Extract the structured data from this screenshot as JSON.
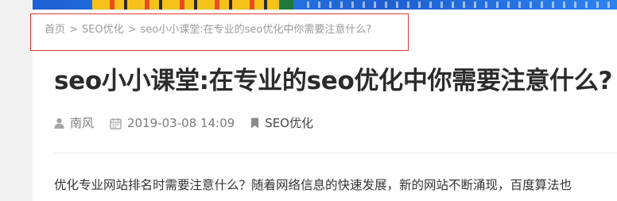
{
  "breadcrumb": {
    "home": "首页",
    "separator": ">",
    "category": "SEO优化",
    "current": "seo小小课堂:在专业的seo优化中你需要注意什么?"
  },
  "article": {
    "title": "seo小小课堂:在专业的seo优化中你需要注意什么?",
    "author": "南风",
    "date": "2019-03-08 14:09",
    "category": "SEO优化",
    "excerpt": "优化专业网站排名时需要注意什么？随着网络信息的快速发展，新的网站不断涌现，百度算法也"
  },
  "colors": {
    "highlight_box": "#d93b3b",
    "banner": "#1d5fd6",
    "title": "#2b2b2b",
    "meta": "#7b7b7b"
  },
  "icons": {
    "author": "user-icon",
    "date": "calendar-icon",
    "category": "bookmark-icon"
  }
}
